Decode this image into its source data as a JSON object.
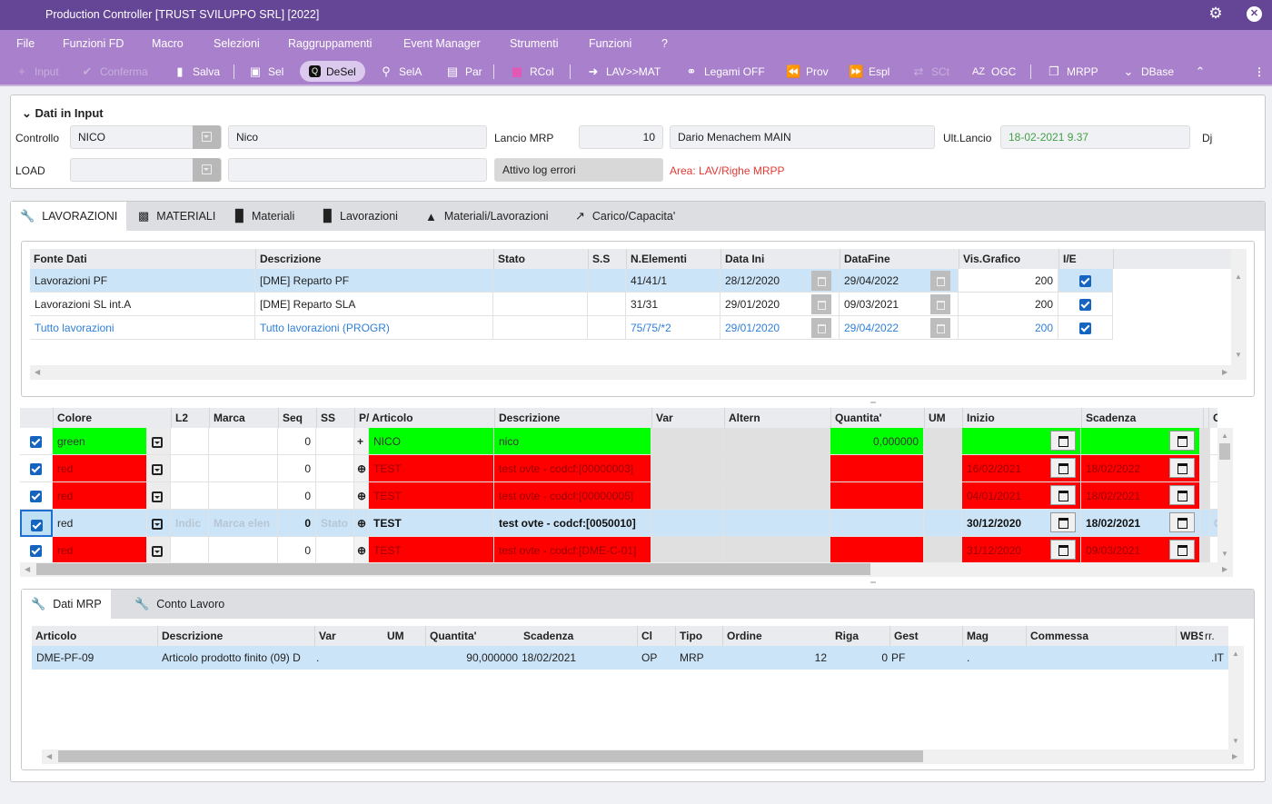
{
  "window": {
    "title": "Production Controller [TRUST SVILUPPO SRL] [2022]",
    "settings_icon": "gear-icon",
    "close_icon": "close-icon"
  },
  "menu": [
    "File",
    "Funzioni FD",
    "Macro",
    "Selezioni",
    "Raggruppamenti",
    "Event Manager",
    "Strumenti",
    "Funzioni",
    "?"
  ],
  "toolbar": [
    {
      "label": "Input",
      "icon": "plus-icon",
      "state": "disabled"
    },
    {
      "label": "Conferma",
      "icon": "check-icon",
      "state": "disabled"
    },
    {
      "label": "Salva",
      "icon": "database-icon",
      "state": "normal"
    },
    {
      "label": "Sel",
      "icon": "binoculars-icon",
      "state": "normal"
    },
    {
      "label": "DeSel",
      "icon": "search-box-icon",
      "state": "active"
    },
    {
      "label": "SelA",
      "icon": "search-icon",
      "state": "normal"
    },
    {
      "label": "Par",
      "icon": "document-plus-icon",
      "state": "normal"
    },
    {
      "label": "RCol",
      "icon": "color-grid-icon",
      "state": "normal"
    },
    {
      "label": "LAV>>MAT",
      "icon": "arrow-right-icon",
      "state": "normal"
    },
    {
      "label": "Legami OFF",
      "icon": "link-icon",
      "state": "normal"
    },
    {
      "label": "Prov",
      "icon": "rewind-icon",
      "state": "normal"
    },
    {
      "label": "Espl",
      "icon": "fast-forward-icon",
      "state": "normal"
    },
    {
      "label": "SCt",
      "icon": "shuffle-icon",
      "state": "disabled"
    },
    {
      "label": "OGC",
      "icon": "sort-az-icon",
      "state": "normal"
    },
    {
      "label": "MRPP",
      "icon": "windows-icon",
      "state": "normal"
    },
    {
      "label": "DBase",
      "icon": "chevron-down-icon",
      "state": "normal"
    },
    {
      "label": "",
      "icon": "chevron-up-icon",
      "state": "normal"
    }
  ],
  "input_panel": {
    "title": "Dati in Input",
    "controllo_label": "Controllo",
    "controllo_code": "NICO",
    "controllo_desc": "Nico",
    "load_label": "LOAD",
    "load_code": "",
    "load_desc": "",
    "lancio_label": "Lancio MRP",
    "lancio_value": "10",
    "lancio_user": "Dario Menachem MAIN",
    "log_label": "Attivo log errori",
    "area_text": "Area: LAV/Righe MRPP",
    "ult_lancio_label": "Ult.Lancio",
    "ult_lancio_value": "18-02-2021  9.37",
    "dj_label": "Dj"
  },
  "main_tabs": [
    {
      "label": "LAVORAZIONI",
      "icon": "wrench-icon",
      "active": true
    },
    {
      "label": "MATERIALI",
      "icon": "building-icon",
      "active": false
    },
    {
      "label": "Materiali",
      "icon": "bar-chart-icon",
      "active": false
    },
    {
      "label": "Lavorazioni",
      "icon": "bar-chart-icon",
      "active": false
    },
    {
      "label": "Materiali/Lavorazioni",
      "icon": "area-chart-icon",
      "active": false
    },
    {
      "label": "Carico/Capacita'",
      "icon": "line-chart-icon",
      "active": false
    }
  ],
  "sources_table": {
    "columns": [
      "Fonte Dati",
      "Descrizione",
      "Stato",
      "S.S",
      "N.Elementi",
      "Data Ini",
      "DataFine",
      "Vis.Grafico",
      "I/E"
    ],
    "rows": [
      {
        "fonte": "Lavorazioni PF",
        "descr": "[DME] Reparto PF",
        "stato": "",
        "ss": "",
        "nelem": "41/41/1",
        "data_ini": "28/12/2020",
        "data_fine": "29/04/2022",
        "vis": "200",
        "ie": true,
        "selected": true,
        "link": false
      },
      {
        "fonte": "Lavorazioni SL int.A",
        "descr": "[DME] Reparto SLA",
        "stato": "",
        "ss": "",
        "nelem": "31/31",
        "data_ini": "29/01/2020",
        "data_fine": "09/03/2021",
        "vis": "200",
        "ie": true,
        "selected": false,
        "link": false
      },
      {
        "fonte": "Tutto lavorazioni",
        "descr": "Tutto lavorazioni (PROGR)",
        "stato": "",
        "ss": "",
        "nelem": "75/75/*2",
        "data_ini": "29/01/2020",
        "data_fine": "29/04/2022",
        "vis": "200",
        "ie": true,
        "selected": false,
        "link": true
      }
    ]
  },
  "lines_table": {
    "columns": [
      "",
      "Colore",
      "",
      "L2",
      "Marca",
      "Seq",
      "SS",
      "P/",
      "Articolo",
      "Descrizione",
      "Var",
      "Altern",
      "Quantita'",
      "UM",
      "Inizio",
      "Scadenza",
      "",
      "Comr"
    ],
    "rows": [
      {
        "checked": true,
        "colore": "green",
        "l2": "",
        "marca": "",
        "seq": "0",
        "ss": "",
        "p_icon": "plus-icon",
        "articolo": "NICO",
        "descr": "nico",
        "var": "",
        "altern": "",
        "qta": "0,000000",
        "um": "",
        "inizio": "",
        "scadenza": "",
        "comm": "",
        "row_color": "green",
        "selected": false
      },
      {
        "checked": true,
        "colore": "red",
        "l2": "",
        "marca": "",
        "seq": "0",
        "ss": "",
        "p_icon": "circle-plus-icon",
        "articolo": "TEST",
        "descr": "test ovte - codcf:[00000003]",
        "var": "",
        "altern": "",
        "qta": "",
        "um": "",
        "inizio": "16/02/2021",
        "scadenza": "18/02/2022",
        "comm": "",
        "row_color": "red",
        "selected": false
      },
      {
        "checked": true,
        "colore": "red",
        "l2": "",
        "marca": "",
        "seq": "0",
        "ss": "",
        "p_icon": "circle-plus-icon",
        "articolo": "TEST",
        "descr": "test ovte - codcf:[00000005]",
        "var": "",
        "altern": "",
        "qta": "",
        "um": "",
        "inizio": "04/01/2021",
        "scadenza": "18/02/2021",
        "comm": "",
        "row_color": "red",
        "selected": false
      },
      {
        "checked": true,
        "colore": "red",
        "l2": "Indic",
        "marca": "Marca elen",
        "seq": "0",
        "ss": "Stato",
        "p_icon": "circle-plus-icon",
        "articolo": "TEST",
        "descr": "test ovte - codcf:[0050010]",
        "var": "",
        "altern": "",
        "qta": "",
        "um": "",
        "inizio": "30/12/2020",
        "scadenza": "18/02/2021",
        "comm": "Com",
        "row_color": "selected",
        "selected": true
      },
      {
        "checked": true,
        "colore": "red",
        "l2": "",
        "marca": "",
        "seq": "0",
        "ss": "",
        "p_icon": "circle-plus-icon",
        "articolo": "TEST",
        "descr": "test ovte - codcf:[DME-C-01]",
        "var": "",
        "altern": "",
        "qta": "",
        "um": "",
        "inizio": "31/12/2020",
        "scadenza": "09/03/2021",
        "comm": "",
        "row_color": "red",
        "selected": false
      }
    ]
  },
  "bottom_tabs": [
    {
      "label": "Dati MRP",
      "icon": "wrench-icon",
      "active": true
    },
    {
      "label": "Conto Lavoro",
      "icon": "wrench-icon",
      "active": false
    }
  ],
  "mrp_table": {
    "columns": [
      "Articolo",
      "Descrizione",
      "Var",
      "UM",
      "Quantita'",
      "Scadenza",
      "Cl",
      "Tipo",
      "Ordine",
      "Riga",
      "Gest",
      "Mag",
      "Commessa",
      "WBS",
      "rr."
    ],
    "rows": [
      {
        "articolo": "DME-PF-09",
        "descr": "Articolo prodotto finito (09) D",
        "var": ".",
        "um": "",
        "qta": "90,000000",
        "scadenza": "18/02/2021",
        "cl": "OP",
        "tipo": "MRP",
        "ordine": "12",
        "riga": "0",
        "gest": "PF",
        "mag": ".",
        "commessa": "",
        "wbs": "",
        "rr": ".IT"
      }
    ]
  },
  "colors": {
    "title_bar": "#654696",
    "menu_bar": "#a980cb",
    "row_green": "#00ff00",
    "row_red": "#ff0000",
    "selected_row": "#cce4f7",
    "link_text": "#2f7fd9",
    "area_text": "#e53935",
    "ult_lancio_text": "#43a047"
  }
}
